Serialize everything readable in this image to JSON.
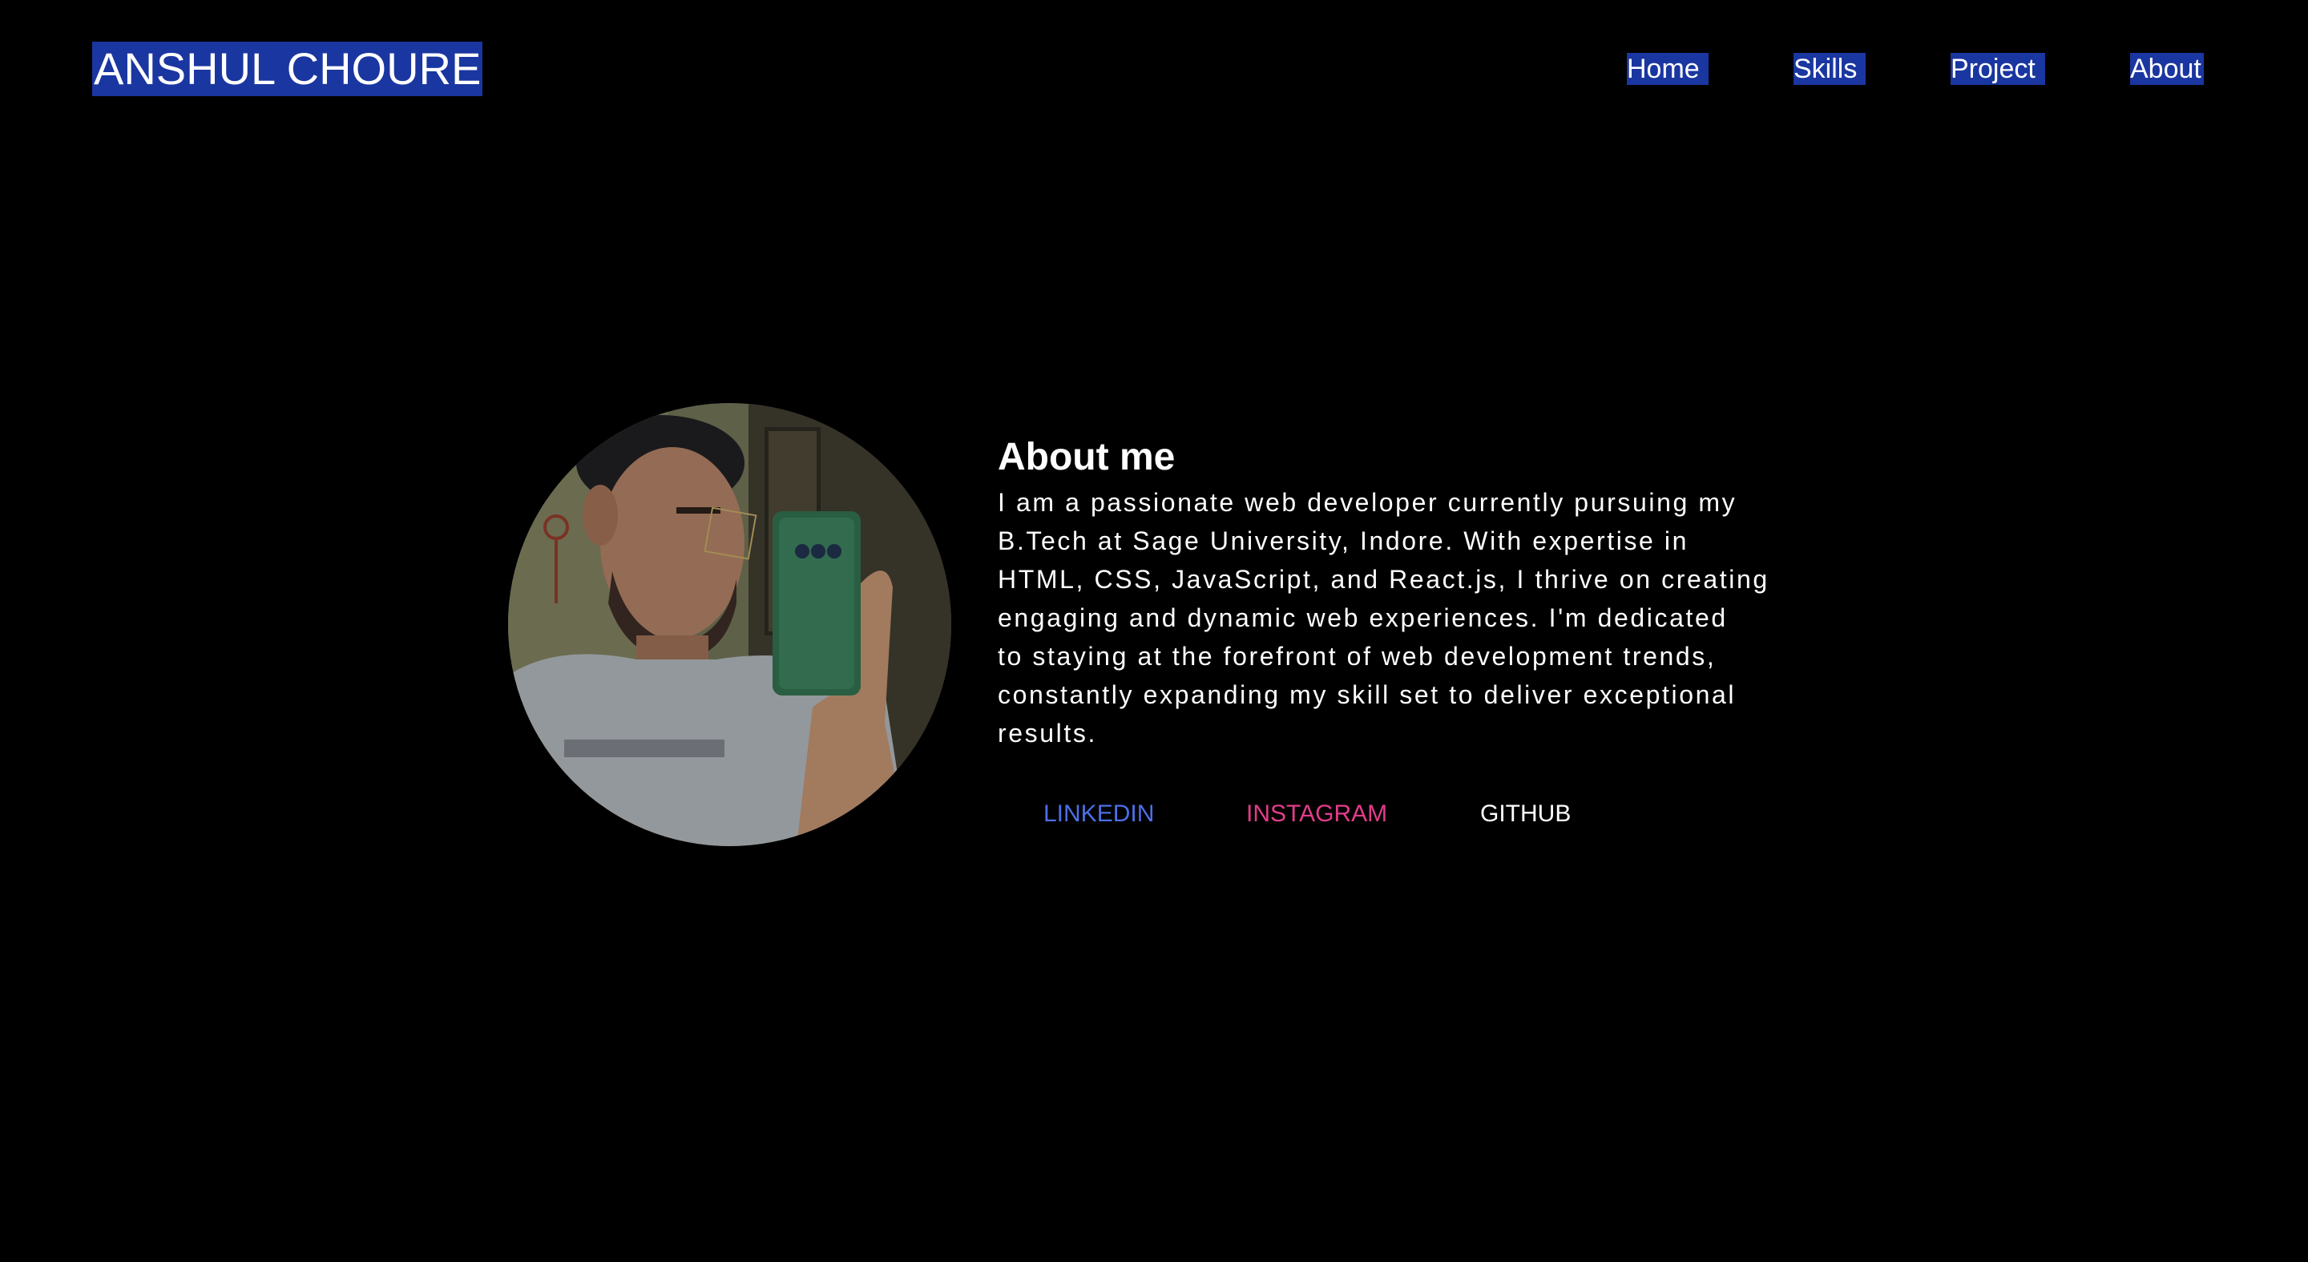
{
  "header": {
    "brand": "ANSHUL CHOURE",
    "nav": {
      "home": "Home",
      "skills": "Skills",
      "project": "Project",
      "about": "About"
    }
  },
  "about": {
    "title": "About me",
    "paragraph_lines": [
      "I am a passionate web developer currently pursuing my",
      "B.Tech at Sage University, Indore. With expertise in",
      "HTML, CSS, JavaScript, and React.js, I thrive on creating",
      "engaging and dynamic web experiences. I'm dedicated",
      "to staying at the forefront of web development trends,",
      "constantly expanding my skill set to deliver exceptional",
      "results."
    ],
    "social": {
      "linkedin": "LINKEDIN",
      "instagram": "INSTAGRAM",
      "github": "GITHUB"
    }
  },
  "colors": {
    "background": "#000000",
    "nav_highlight": "#1a36a0",
    "text": "#ffffff",
    "linkedin": "#4d6fe6",
    "instagram": "#e23c8a",
    "github": "#ffffff"
  }
}
